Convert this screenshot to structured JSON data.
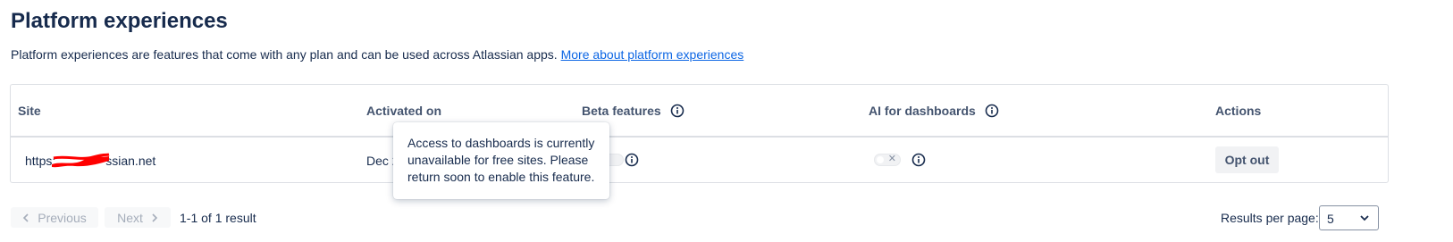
{
  "page": {
    "title": "Platform experiences",
    "intro": "Platform experiences are features that come with any plan and can be used across Atlassian apps.",
    "intro_link": "More about platform experiences"
  },
  "table": {
    "columns": {
      "site": "Site",
      "activated_on": "Activated on",
      "beta_features": "Beta features",
      "ai_dashboards": "AI for dashboards",
      "actions": "Actions"
    },
    "rows": [
      {
        "site_prefix": "https:",
        "site_suffix": "ssian.net",
        "activated_on": "Dec 2",
        "beta_toggle_on": false,
        "ai_toggle_on": false,
        "action": "Opt out"
      }
    ]
  },
  "tooltip": {
    "text": "Access to dashboards is currently unavailable for free sites. Please return soon to enable this feature."
  },
  "pagination": {
    "previous": "Previous",
    "next": "Next",
    "result_count": "1-1 of 1 result",
    "per_page_label": "Results per page:",
    "per_page_value": "5"
  },
  "colors": {
    "link": "#0c66e4",
    "text": "#172b4d",
    "subtle": "#44546f",
    "redaction": "#ff0000"
  },
  "icons": {
    "info": "info-icon",
    "chevron_left": "chevron-left-icon",
    "chevron_right": "chevron-right-icon",
    "chevron_down": "chevron-down-icon"
  }
}
